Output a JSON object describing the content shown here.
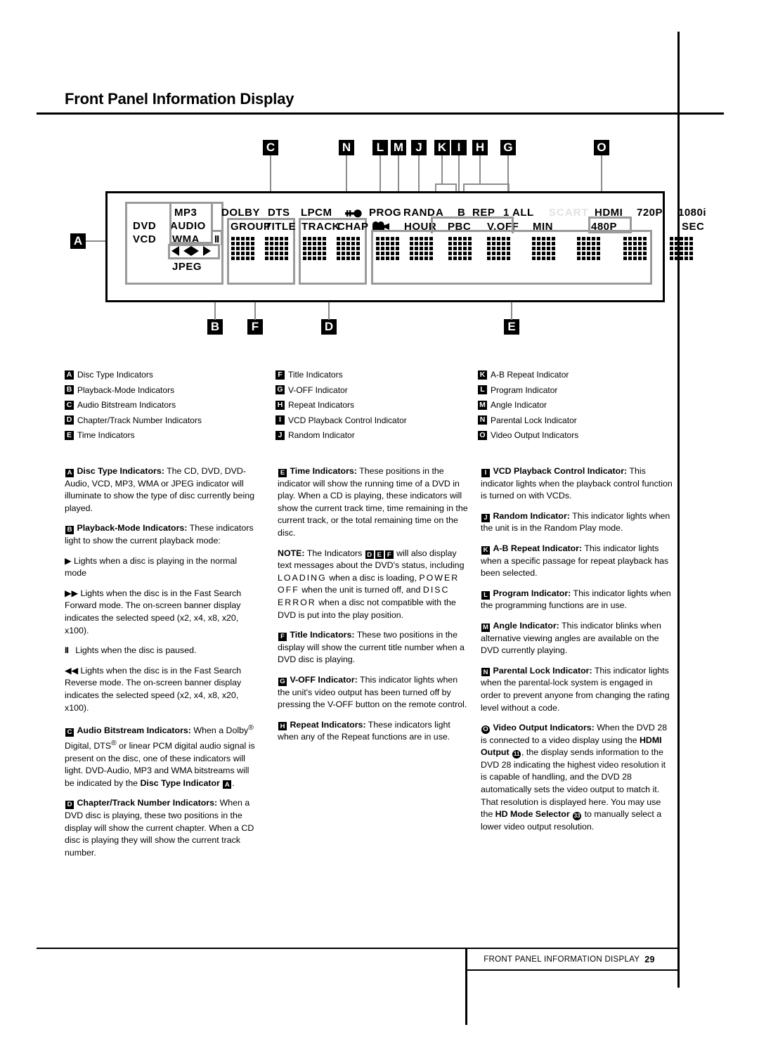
{
  "page": {
    "title": "Front Panel Information Display",
    "footer_text": "FRONT PANEL INFORMATION DISPLAY",
    "footer_page": "29"
  },
  "callouts_top": [
    {
      "letter": "C"
    },
    {
      "letter": "N"
    },
    {
      "letter": "L"
    },
    {
      "letter": "M"
    },
    {
      "letter": "J"
    },
    {
      "letter": "K"
    },
    {
      "letter": "I"
    },
    {
      "letter": "H"
    },
    {
      "letter": "G"
    },
    {
      "letter": "O"
    }
  ],
  "callouts_bottom": [
    {
      "letter": "B"
    },
    {
      "letter": "F"
    },
    {
      "letter": "D"
    },
    {
      "letter": "E"
    }
  ],
  "callout_left": {
    "letter": "A"
  },
  "display": {
    "disc_type": {
      "left": [
        "DVD",
        "VCD"
      ],
      "right": [
        "MP3",
        "AUDIO",
        "WMA",
        "JPEG"
      ],
      "pause_glyph": "II"
    },
    "bitstream_labels": [
      "DOLBY",
      "DTS",
      "LPCM"
    ],
    "key_icon": "key-icon",
    "prog_label": "PROG",
    "camera_icon": "camera-icon",
    "field_labels_top": [
      "RAND",
      "A",
      "B",
      "REP",
      "1",
      "ALL"
    ],
    "scart_ghost": "SCART",
    "video_top": [
      "HDMI",
      "720P",
      "1080i"
    ],
    "groups": [
      {
        "top": "GROUP",
        "cells": 5
      },
      {
        "top": "TITLE",
        "cells": 5
      },
      {
        "top": "TRACK",
        "cells": 5
      },
      {
        "top": "CHAP",
        "cells": 5
      }
    ],
    "time_labels": [
      "HOUR",
      "PBC",
      "V.OFF",
      "MIN",
      "480P",
      "SEC"
    ]
  },
  "legend": {
    "col1": [
      {
        "letter": "A",
        "label": "Disc Type Indicators"
      },
      {
        "letter": "B",
        "label": "Playback-Mode Indicators"
      },
      {
        "letter": "C",
        "label": "Audio Bitstream Indicators"
      },
      {
        "letter": "D",
        "label": "Chapter/Track Number Indicators"
      },
      {
        "letter": "E",
        "label": "Time Indicators"
      }
    ],
    "col2": [
      {
        "letter": "F",
        "label": "Title Indicators"
      },
      {
        "letter": "G",
        "label": "V-OFF Indicator"
      },
      {
        "letter": "H",
        "label": "Repeat Indicators"
      },
      {
        "letter": "I",
        "label": "VCD Playback Control Indicator"
      },
      {
        "letter": "J",
        "label": "Random Indicator"
      }
    ],
    "col3": [
      {
        "letter": "K",
        "label": "A-B Repeat Indicator"
      },
      {
        "letter": "L",
        "label": "Program Indicator"
      },
      {
        "letter": "M",
        "label": "Angle Indicator"
      },
      {
        "letter": "N",
        "label": "Parental Lock Indicator"
      },
      {
        "letter": "O",
        "label": "Video Output Indicators"
      }
    ]
  },
  "body": {
    "col1": {
      "a_head": "Disc Type Indicators:",
      "a_text": " The CD, DVD, DVD-Audio, VCD, MP3, WMA or JPEG indicator will illuminate to show the type of disc currently being played.",
      "b_head": "Playback-Mode Indicators:",
      "b_text": " These indicators light to show the current playback mode:",
      "play_text": "Lights when a disc is playing in the normal mode",
      "ffwd_text": "Lights when the disc is in the Fast Search Forward mode. The on-screen banner display indicates the selected speed (x2, x4, x8, x20, x100).",
      "pause_text": "Lights when the disc is paused.",
      "frev_text": "Lights when the disc is in the Fast Search Reverse mode. The on-screen banner display indicates the selected speed (x2, x4, x8, x20, x100).",
      "c_head": "Audio Bitstream Indicators:",
      "c_text1": " When a Dolby",
      "c_text2": " Digital, DTS",
      "c_text3": " or linear PCM digital audio signal is present on the disc, one of these indicators will light. DVD-Audio, MP3 and WMA bitstreams will be indicated by the ",
      "c_bold_tail": "Disc Type Indicator",
      "c_tail_period": ".",
      "d_head": "Chapter/Track Number Indicators:",
      "d_text": " When a DVD disc is playing, these two positions in the display will show the current chapter. When a CD disc is playing they will show the current track number."
    },
    "col2": {
      "e_head": "Time Indicators:",
      "e_text": " These positions in the indicator will show the running time of a DVD in play. When a CD is playing, these indicators will show the current track time, time remaining in the current track, or the total remaining time on the disc.",
      "note_head": "NOTE:",
      "note_text1": " The Indicators ",
      "note_text2": " will also display text messages about the DVD's status, including ",
      "note_loading": "LOADING",
      "note_loading_tail": " when a disc is loading, ",
      "note_poweroff": "POWER OFF",
      "note_poweroff_tail": " when the unit is turned off, and ",
      "note_discerror": "DISC ERROR",
      "note_discerror_tail": " when a disc not compatible with the DVD is put into the play position.",
      "f_head": "Title Indicators:",
      "f_text": " These two positions in the display will show the current title number when a DVD disc is playing.",
      "g_head": "V-OFF Indicator:",
      "g_text": " This indicator lights when the unit's video output has been turned off by pressing the V-OFF button on the remote control.",
      "h_head": "Repeat Indicators:",
      "h_text": " These indicators light when any of the Repeat functions are in use."
    },
    "col3": {
      "i_head": "VCD Playback Control Indicator:",
      "i_text": " This indicator lights when the playback control function is turned on with VCDs.",
      "j_head": "Random Indicator:",
      "j_text": " This indicator lights when the unit is in the Random Play mode.",
      "k_head": "A-B Repeat Indicator:",
      "k_text": " This indicator lights when a specific passage for repeat playback has been selected.",
      "l_head": "Program Indicator:",
      "l_text": " This indicator lights when the programming functions are in use.",
      "m_head": "Angle Indicator:",
      "m_text": " This indicator blinks when alternative viewing angles are available on the DVD currently playing.",
      "n_head": "Parental Lock Indicator:",
      "n_text": " This indicator lights when the parental-lock system is engaged in order to prevent anyone from changing the rating level without a code.",
      "o_head": "Video Output Indicators:",
      "o_text1": " When the DVD 28 is connected to a video display using the ",
      "o_bold1": "HDMI Output",
      "o_num1": "11",
      "o_text2": ", the display sends information to the DVD 28 indicating the highest video resolution it is capable of handling, and the DVD 28 automatically sets the video output to match it. That resolution is displayed here. You may use the ",
      "o_bold2": "HD Mode Selector",
      "o_num2": "33",
      "o_text3": " to manually select a lower video output resolution."
    }
  }
}
